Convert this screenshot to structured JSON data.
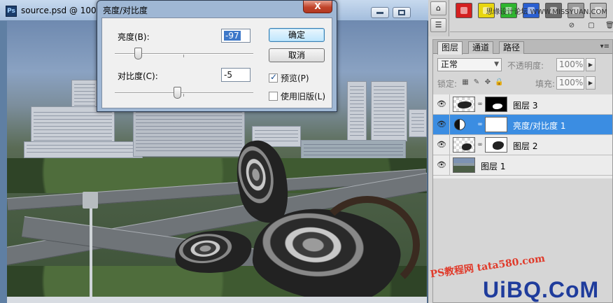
{
  "document": {
    "title": "source.psd @ 100",
    "icon": "photoshop-file-icon"
  },
  "dialog": {
    "title": "亮度/对比度",
    "close_label": "X",
    "brightness": {
      "label": "亮度(B):",
      "value": "-97"
    },
    "contrast": {
      "label": "对比度(C):",
      "value": "-5"
    },
    "ok_label": "确定",
    "cancel_label": "取消",
    "preview": {
      "label": "预览(P)",
      "checked": true
    },
    "legacy": {
      "label": "使用旧版(L)",
      "checked": false
    }
  },
  "styles": {
    "swatches": [
      "#d42020",
      "#e8d60e",
      "#2fb52f",
      "#2a5fd1",
      "#6a6a6a",
      "#9a9a9a",
      "#b8b8b8"
    ]
  },
  "layers_panel": {
    "tabs": [
      {
        "label": "图层",
        "active": true
      },
      {
        "label": "通道",
        "active": false
      },
      {
        "label": "路径",
        "active": false
      }
    ],
    "blend_mode": "正常",
    "opacity_label": "不透明度:",
    "opacity_value": "100%",
    "lock_label": "锁定:",
    "fill_label": "填充:",
    "fill_value": "100%",
    "layers": [
      {
        "name": "图层 3",
        "type": "masked",
        "selected": false
      },
      {
        "name": "亮度/对比度 1",
        "type": "adjustment",
        "selected": true
      },
      {
        "name": "图层 2",
        "type": "masked",
        "selected": false
      },
      {
        "name": "图层 1",
        "type": "image",
        "selected": false
      }
    ]
  },
  "watermarks": {
    "top": "思缘设计论坛 WWW.MISSYUAN.COM",
    "ps": "PS教程网 tata580.com",
    "uibq": "UiBQ.CoM"
  }
}
